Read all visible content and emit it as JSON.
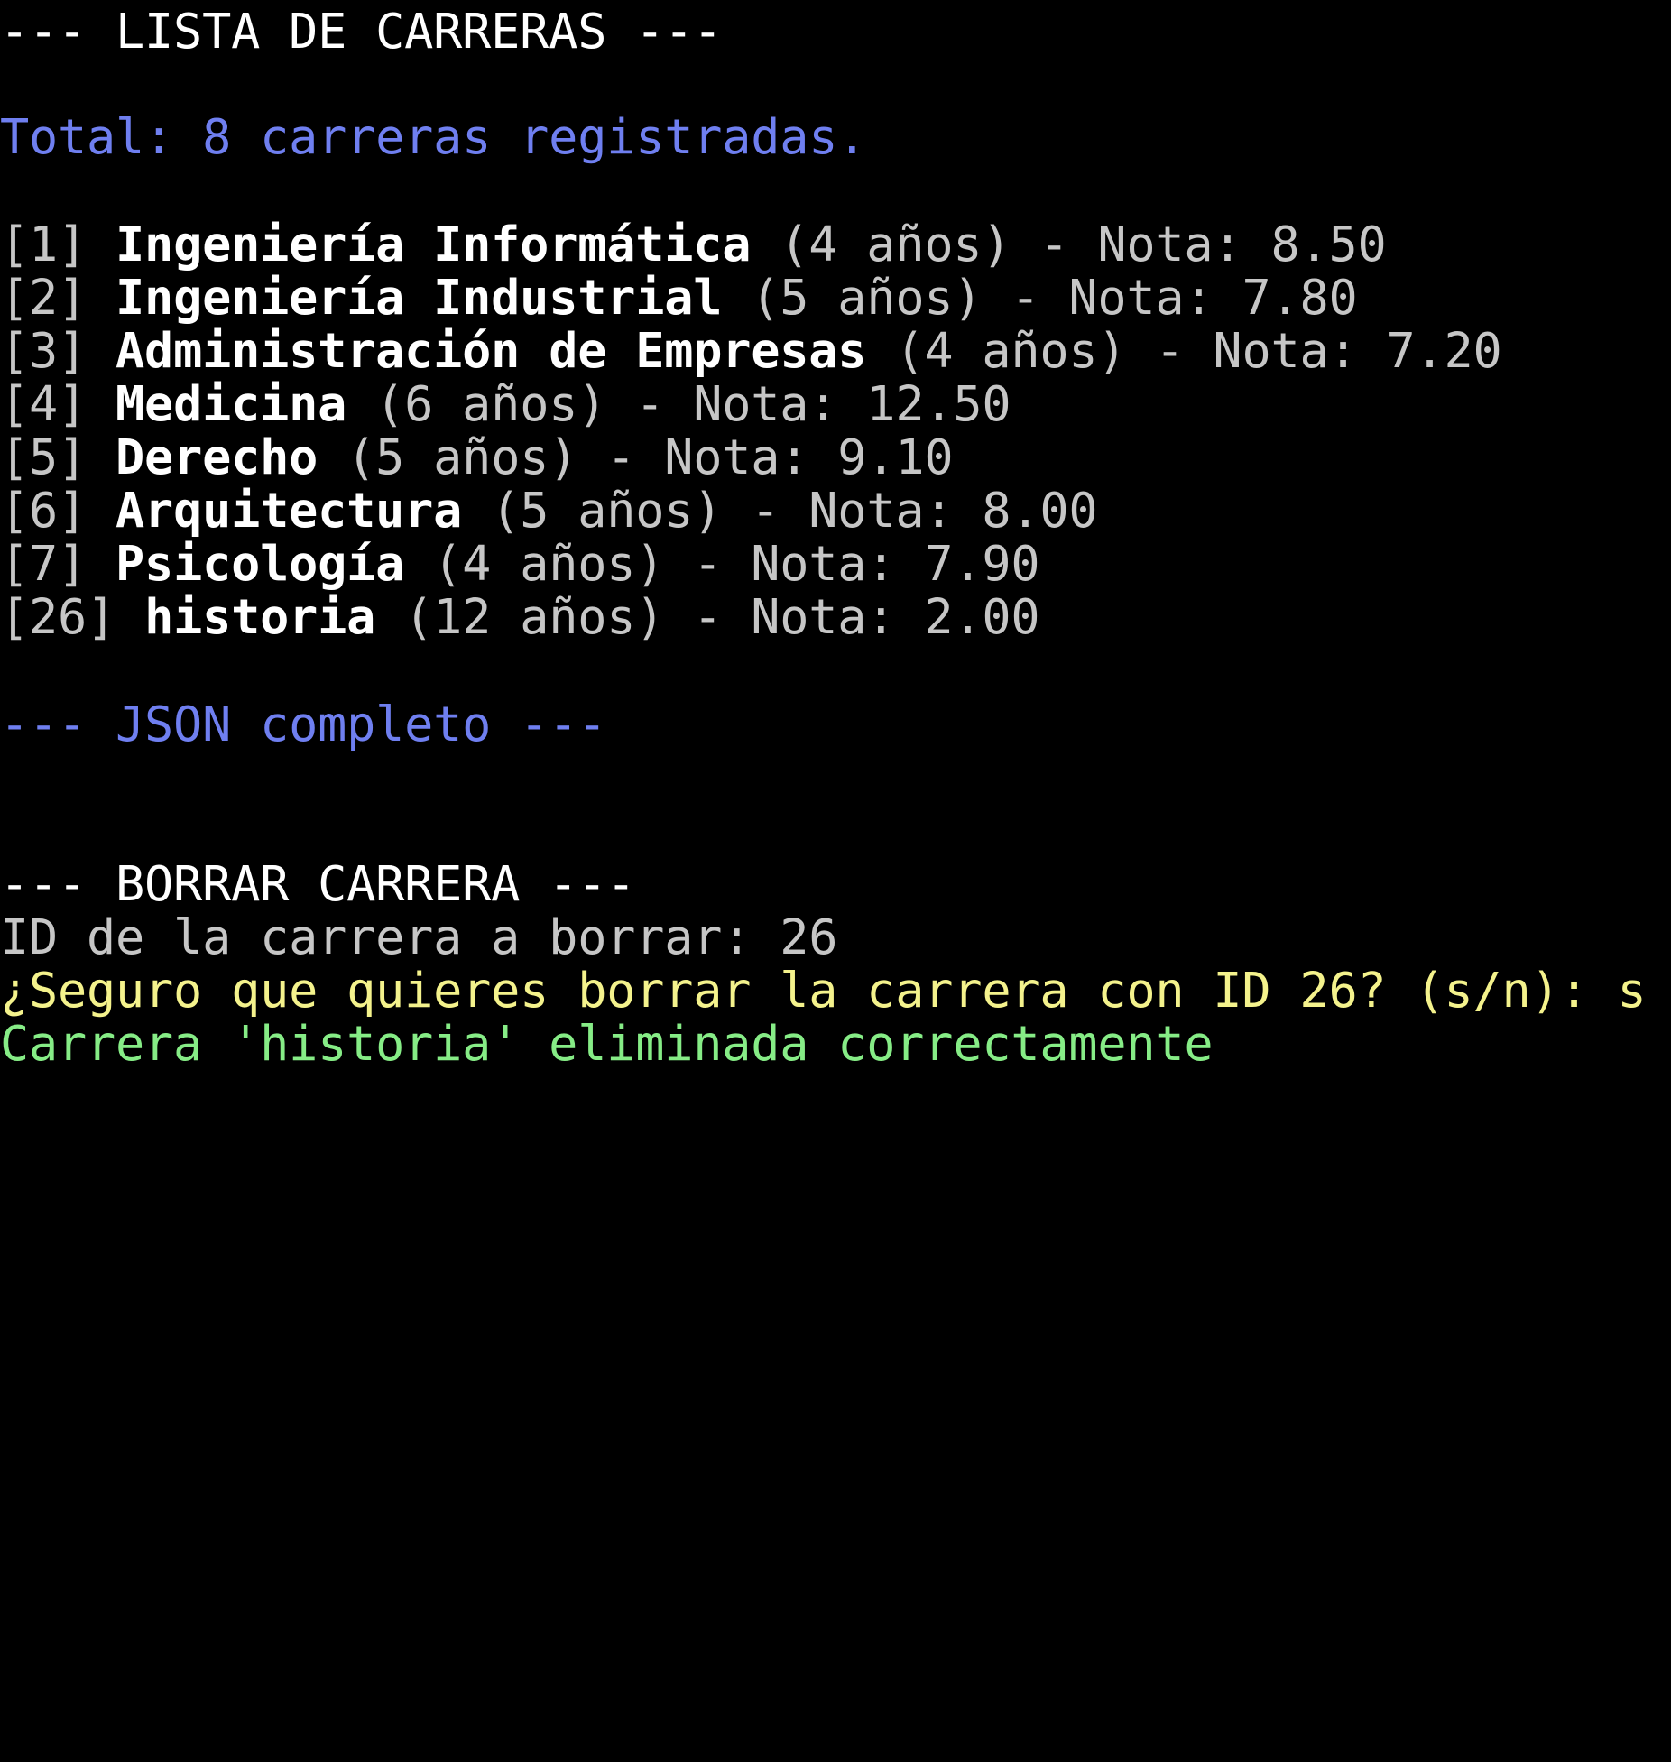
{
  "header": {
    "list_title": "--- LISTA DE CARRERAS ---",
    "total": "Total: 8 carreras registradas."
  },
  "careers": [
    {
      "id": "[1]",
      "name": "Ingeniería Informática",
      "details": "(4 años) - Nota: 8.50"
    },
    {
      "id": "[2]",
      "name": "Ingeniería Industrial",
      "details": "(5 años) - Nota: 7.80"
    },
    {
      "id": "[3]",
      "name": "Administración de Empresas",
      "details": "(4 años) - Nota: 7.20"
    },
    {
      "id": "[4]",
      "name": "Medicina",
      "details": "(6 años) - Nota: 12.50"
    },
    {
      "id": "[5]",
      "name": "Derecho",
      "details": "(5 años) - Nota: 9.10"
    },
    {
      "id": "[6]",
      "name": "Arquitectura",
      "details": "(5 años) - Nota: 8.00"
    },
    {
      "id": "[7]",
      "name": "Psicología",
      "details": "(4 años) - Nota: 7.90"
    },
    {
      "id": "[26]",
      "name": "historia",
      "details": "(12 años) - Nota: 2.00"
    }
  ],
  "json_section": {
    "title": "--- JSON completo ---"
  },
  "delete_section": {
    "title": "--- BORRAR CARRERA ---",
    "id_prompt": "ID de la carrera a borrar: 26",
    "confirm_prompt": "¿Seguro que quieres borrar la carrera con ID 26? (s/n): s",
    "success": "Carrera 'historia' eliminada correctamente"
  },
  "colors": {
    "background": "#000000",
    "white": "#ffffff",
    "blue": "#6f7ff0",
    "gray": "#c6c6c6",
    "yellow": "#f4f28c",
    "green": "#86ec86"
  }
}
